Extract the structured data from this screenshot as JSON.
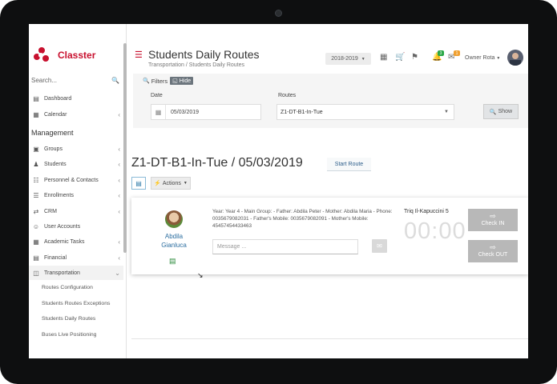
{
  "app": {
    "name": "Classter"
  },
  "sidebar": {
    "search_placeholder": "Search...",
    "items_top": [
      {
        "label": "Dashboard",
        "icon": "monitor-icon"
      },
      {
        "label": "Calendar",
        "icon": "calendar-icon"
      }
    ],
    "section_title": "Management",
    "items": [
      {
        "label": "Groups",
        "icon": "groups-icon"
      },
      {
        "label": "Students",
        "icon": "student-icon"
      },
      {
        "label": "Personnel & Contacts",
        "icon": "contacts-icon"
      },
      {
        "label": "Enrollments",
        "icon": "enrollments-icon"
      },
      {
        "label": "CRM",
        "icon": "shuffle-icon"
      },
      {
        "label": "User Accounts",
        "icon": "user-accounts-icon"
      },
      {
        "label": "Academic Tasks",
        "icon": "table-icon"
      },
      {
        "label": "Financial",
        "icon": "financial-icon"
      },
      {
        "label": "Transportation",
        "icon": "bus-icon"
      }
    ],
    "transport_subitems": [
      "Routes Configuration",
      "Students Routes Exceptions",
      "Students Daily Routes",
      "Buses Live Positioning"
    ]
  },
  "header": {
    "title": "Students Daily Routes",
    "breadcrumb": [
      "Transportation",
      "Students Daily Routes"
    ],
    "breadcrumb_separator": "/",
    "year": "2018-2019",
    "notif_badge": "3",
    "mail_badge": "1",
    "user": "Owner Rota"
  },
  "filters": {
    "label": "Filters",
    "hide_label": "Hide",
    "date_label": "Date",
    "date_value": "05/03/2019",
    "routes_label": "Routes",
    "route_value": "Z1-DT-B1-In-Tue",
    "show_label": "Show"
  },
  "main": {
    "route_title": "Z1-DT-B1-In-Tue / 05/03/2019",
    "start_route": "Start Route",
    "actions": "Actions",
    "student": {
      "name_line1": "Abdila",
      "name_line2": "Gianluca",
      "info": "Year: Year 4 - Main Group: - Father: Abdila Peter - Mother: Abdila Maria - Phone: 0035679082031 - Father's Mobile: 0035679082091 - Mother's Mobile: 45457454433463",
      "message_placeholder": "Message ...",
      "stop": "Triq Il-Kapuccini 5",
      "timer": "00:00",
      "check_in": "Check IN",
      "check_out": "Check OUT"
    }
  },
  "colors": {
    "brand": "#c8102e",
    "link": "#2c6ea0",
    "check_btn": "#b8b8b8"
  }
}
